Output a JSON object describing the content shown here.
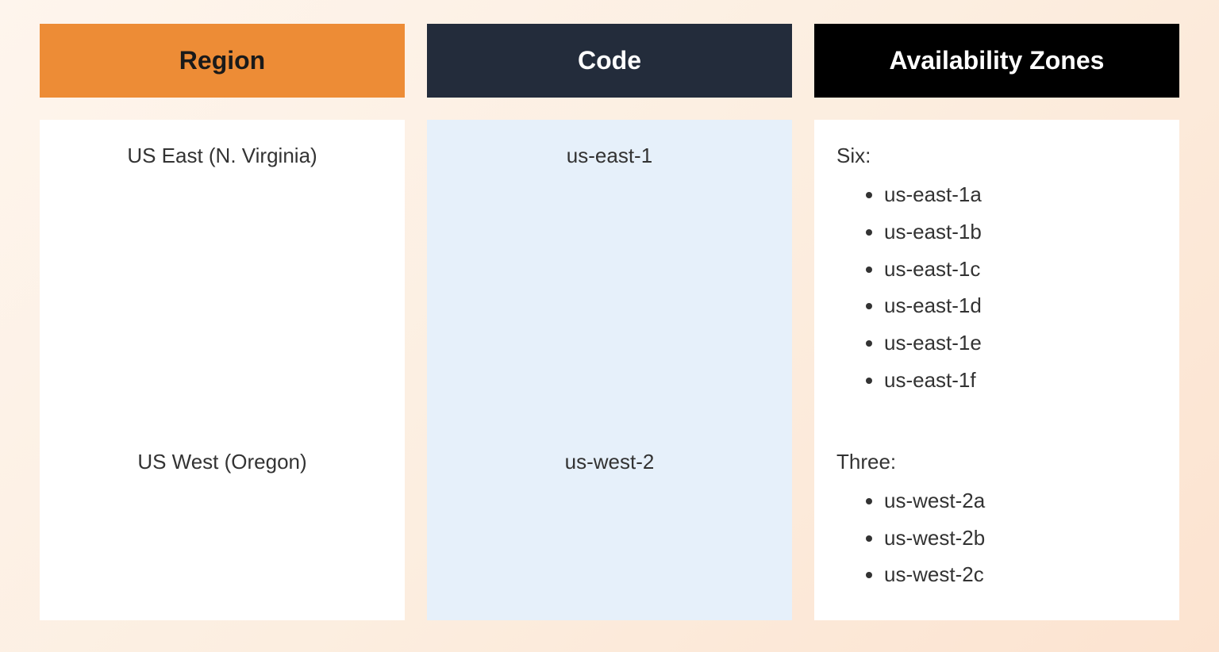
{
  "table": {
    "headers": {
      "region": "Region",
      "code": "Code",
      "az": "Availability Zones"
    },
    "rows": [
      {
        "region": "US East (N. Virginia)",
        "code": "us-east-1",
        "az_label": "Six:",
        "az_items": [
          "us-east-1a",
          "us-east-1b",
          "us-east-1c",
          "us-east-1d",
          "us-east-1e",
          "us-east-1f"
        ]
      },
      {
        "region": "US West (Oregon)",
        "code": "us-west-2",
        "az_label": "Three:",
        "az_items": [
          "us-west-2a",
          "us-west-2b",
          "us-west-2c"
        ]
      }
    ]
  }
}
